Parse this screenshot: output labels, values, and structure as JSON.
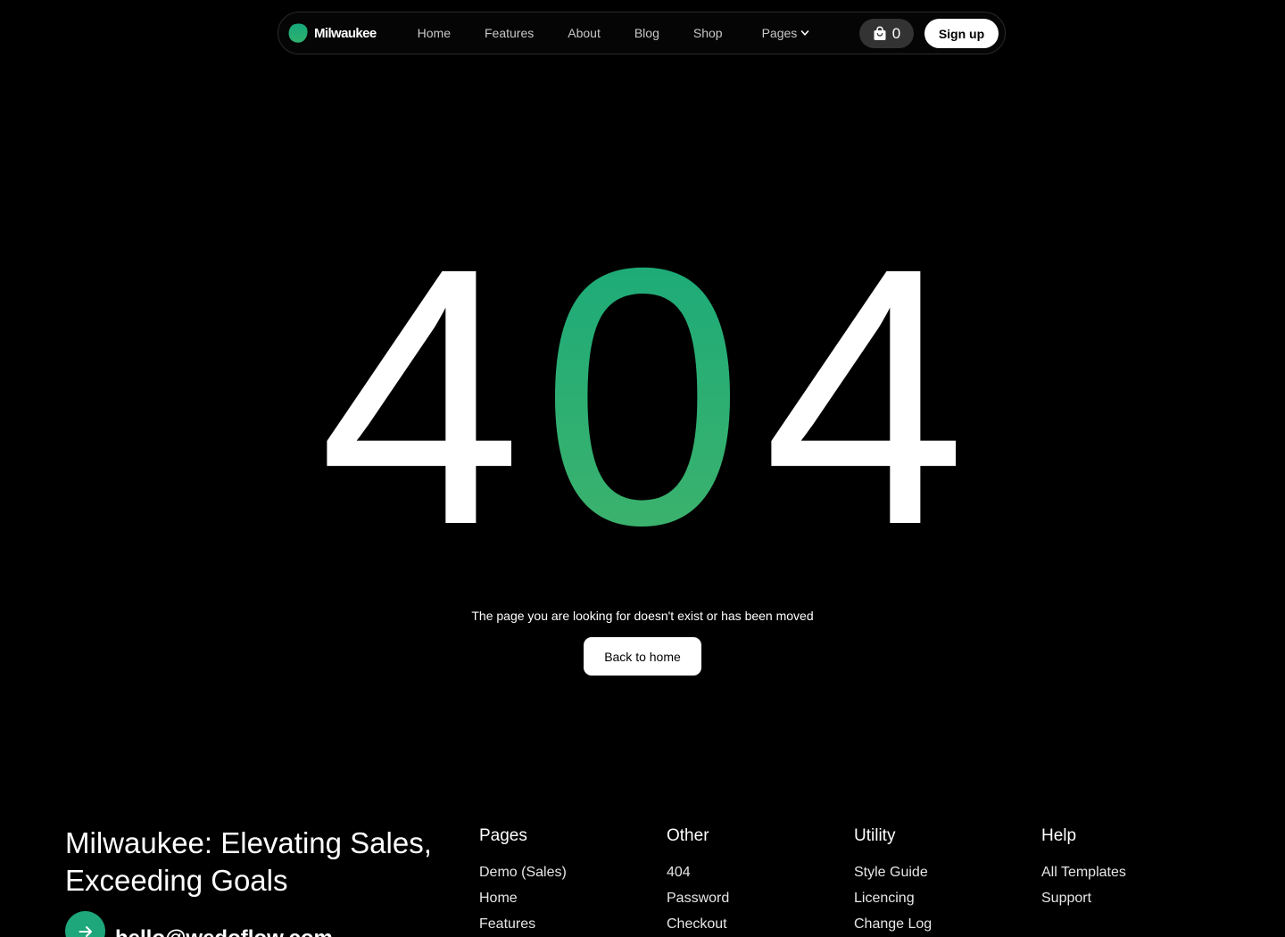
{
  "nav": {
    "brand": "Milwaukee",
    "links": [
      "Home",
      "Features",
      "About",
      "Blog",
      "Shop"
    ],
    "pages_label": "Pages",
    "cart_count": "0",
    "signup_label": "Sign up"
  },
  "hero": {
    "digit_left": "4",
    "digit_middle": "0",
    "digit_right": "4",
    "message": "The page you are looking for doesn't exist or has been moved",
    "back_label": "Back to home"
  },
  "footer": {
    "tagline": "Milwaukee: Elevating Sales, Exceeding Goals",
    "email": "hello@wedoflow.com",
    "columns": [
      {
        "title": "Pages",
        "items": [
          "Demo (Sales)",
          "Home",
          "Features"
        ]
      },
      {
        "title": "Other",
        "items": [
          "404",
          "Password",
          "Checkout"
        ]
      },
      {
        "title": "Utility",
        "items": [
          "Style Guide",
          "Licencing",
          "Change Log"
        ]
      },
      {
        "title": "Help",
        "items": [
          "All Templates",
          "Support"
        ]
      }
    ]
  },
  "colors": {
    "background": "#000000",
    "accent_green_top": "#16a97b",
    "accent_green_bottom": "#43b46a",
    "cart_bg": "#333333",
    "white": "#ffffff"
  },
  "icons": {
    "brand": "leaf-blob-icon",
    "pages_dropdown": "chevron-down-icon",
    "cart": "shopping-bag-icon",
    "email": "arrow-right-icon"
  }
}
